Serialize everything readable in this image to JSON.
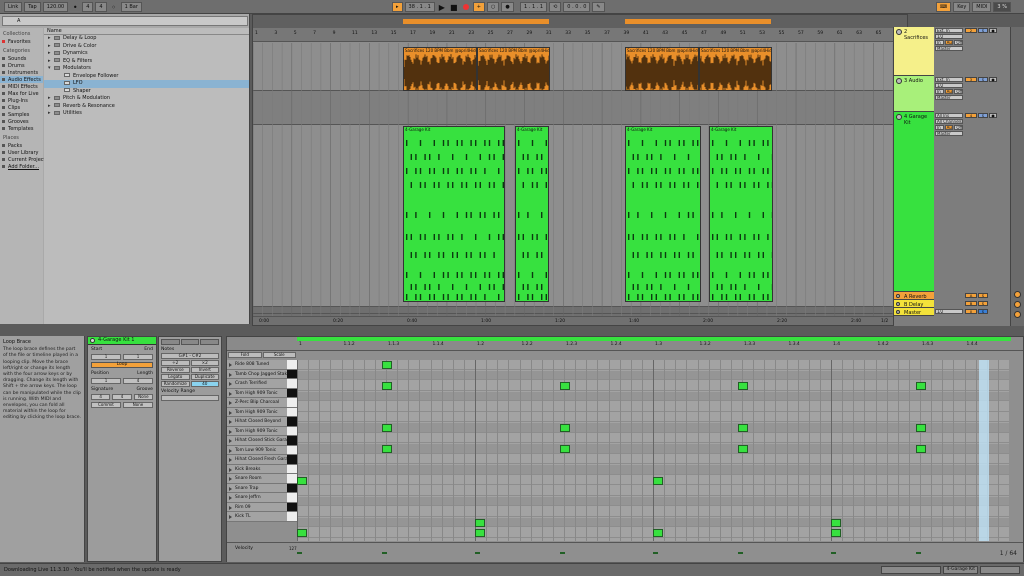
{
  "transport": {
    "link": "Link",
    "tap": "Tap",
    "tempo": "120.00",
    "time_sig_num": "4",
    "time_sig_den": "4",
    "quantize": "1 Bar",
    "arr_position": "38 . 1 . 1",
    "loop_start": "1 . 1 . 1",
    "loop_length": "0 . 0 . 0",
    "key": "Key",
    "midi": "MIDI",
    "cpu": "3 %"
  },
  "browser": {
    "search_value": "A",
    "collections_title": "Collections",
    "favorites": "Favorites",
    "categories_title": "Categories",
    "categories": [
      "Sounds",
      "Drums",
      "Instruments",
      "Audio Effects",
      "MIDI Effects",
      "Max for Live",
      "Plug-Ins",
      "Clips",
      "Samples",
      "Grooves",
      "Templates"
    ],
    "active_category_index": 3,
    "places_title": "Places",
    "places": [
      "Packs",
      "User Library",
      "Current Project",
      "Add Folder..."
    ],
    "column_header": "Name",
    "items": [
      {
        "label": "Delay & Loop",
        "folder": true,
        "open": false
      },
      {
        "label": "Drive & Color",
        "folder": true,
        "open": false
      },
      {
        "label": "Dynamics",
        "folder": true,
        "open": false
      },
      {
        "label": "EQ & Filters",
        "folder": true,
        "open": false
      },
      {
        "label": "Modulators",
        "folder": true,
        "open": true
      },
      {
        "label": "Envelope Follower",
        "folder": false,
        "open": false,
        "indent": true
      },
      {
        "label": "LFO",
        "folder": false,
        "open": false,
        "indent": true,
        "selected": true
      },
      {
        "label": "Shaper",
        "folder": false,
        "open": false,
        "indent": true
      },
      {
        "label": "Pitch & Modulation",
        "folder": true,
        "open": false
      },
      {
        "label": "Reverb & Resonance",
        "folder": true,
        "open": false
      },
      {
        "label": "Utilities",
        "folder": true,
        "open": false
      }
    ]
  },
  "arrangement": {
    "bar_numbers": [
      "1",
      "3",
      "5",
      "7",
      "9",
      "11",
      "13",
      "15",
      "17",
      "19",
      "21",
      "23",
      "25",
      "27",
      "29",
      "31",
      "33",
      "35",
      "37",
      "39",
      "41",
      "43",
      "45",
      "47",
      "49",
      "51",
      "53",
      "55",
      "57",
      "59",
      "61",
      "63",
      "65"
    ],
    "audio_clip_title": "Sacrifices 120 BPM Bbm @apri4Hide",
    "midi_clip_title": "4-Garage Kit",
    "time_labels": [
      "0:00",
      "0:20",
      "0:40",
      "1:00",
      "1:20",
      "1:40",
      "2:00",
      "2:20",
      "2:40",
      "3:00"
    ],
    "scroll_indicator": "1/2"
  },
  "tracks": [
    {
      "name": "2 Sacrifices",
      "color": "#f5f08a",
      "input": "Ext. In",
      "in_channel": "1/2",
      "monitor": [
        "In",
        "Auto",
        "Off"
      ],
      "output": "Master",
      "number": "2"
    },
    {
      "name": "3 Audio",
      "color": "#a8f07a",
      "input": "Ext. In",
      "in_channel": "1/2",
      "monitor": [
        "In",
        "Auto",
        "Off"
      ],
      "output": "Master",
      "number": "3"
    },
    {
      "name": "4 Garage Kit",
      "color": "#37e13f",
      "input": "All Ins",
      "in_channel": "All Channels",
      "monitor": [
        "In",
        "Auto",
        "Off"
      ],
      "output": "Master",
      "number": "4"
    }
  ],
  "returns": [
    {
      "name": "A Reverb",
      "color": "#f3a13a",
      "label": "A"
    },
    {
      "name": "B Delay",
      "color": "#f3e23a",
      "label": "B"
    },
    {
      "name": "Master",
      "color": "#f3e23a",
      "label": "0",
      "output": "1/2"
    }
  ],
  "info": {
    "title": "Loop Brace",
    "body": "The loop brace defines the part of the file or timeline played in a looping clip. Move the brace left/right or change its length with the four arrow keys or by dragging. Change its length with Shift + the arrow keys. The loop can be manipulated while the clip is running. With MIDI and envelopes, you can fold all material within the loop for editing by clicking the loop brace."
  },
  "clip": {
    "name": "4-Garage Kit 1",
    "start_label": "Start",
    "end_label": "End",
    "start_value": "1",
    "end_value": "1",
    "loop_label": "Loop",
    "position_label": "Position",
    "length_label": "Length",
    "position_value": "1",
    "length_value": "4",
    "signature_label": "Signature",
    "groove_label": "Groove",
    "sig_num": "4",
    "sig_den": "4",
    "groove_value": "None",
    "commit_label": "Commit",
    "none_label": "None"
  },
  "notes_panel": {
    "title": "Notes",
    "range": "G#1 - C#2",
    "buttons": [
      [
        "Reverse",
        "Invert"
      ],
      [
        "Legato",
        "Duplicate"
      ]
    ],
    "halve": "÷2",
    "double": "×2",
    "randomize": "Randomize",
    "randomize_value": "40",
    "velocity_range": "Velocity Range"
  },
  "editor": {
    "fold": "Fold",
    "scale": "Scale",
    "ticks": [
      "1",
      "1.1.2",
      "1.1.3",
      "1.1.4",
      "1.2",
      "1.2.2",
      "1.2.3",
      "1.2.4",
      "1.3",
      "1.3.2",
      "1.3.3",
      "1.3.4",
      "1.4",
      "1.4.2",
      "1.4.3",
      "1.4.4"
    ],
    "lanes": [
      "Ride 808 Tuned",
      "Tamb Chop Jagged Stakr",
      "Crash Terrified",
      "Tom High 909 Tonic",
      "Z-Perc Blip Charcoal",
      "Tom High 909 Tonic",
      "Hihat Closed Beyond",
      "Tom High 909 Tonic",
      "Hihat Closed Stick Garage",
      "Tom Low 909 Tonic",
      "Hihat Closed Fresh Garage",
      "Kick Breaks",
      "Snare Room",
      "Snare Trap",
      "Snare Jeffrn",
      "Rim 09",
      "Kick TL"
    ],
    "velocity_label": "Velocity",
    "velocity_max": "127",
    "velocity_min": "1",
    "page": "1 / 64"
  },
  "status": {
    "message": "Downloading Live 11.3.10 - You'll be notified when the update is ready",
    "right_label": "4-Garage Kit"
  },
  "colors": {
    "audio_clip": "#e98f2a",
    "midi_clip": "#37e13f",
    "accent": "#f3a13a",
    "selection": "#8ab3d2"
  }
}
